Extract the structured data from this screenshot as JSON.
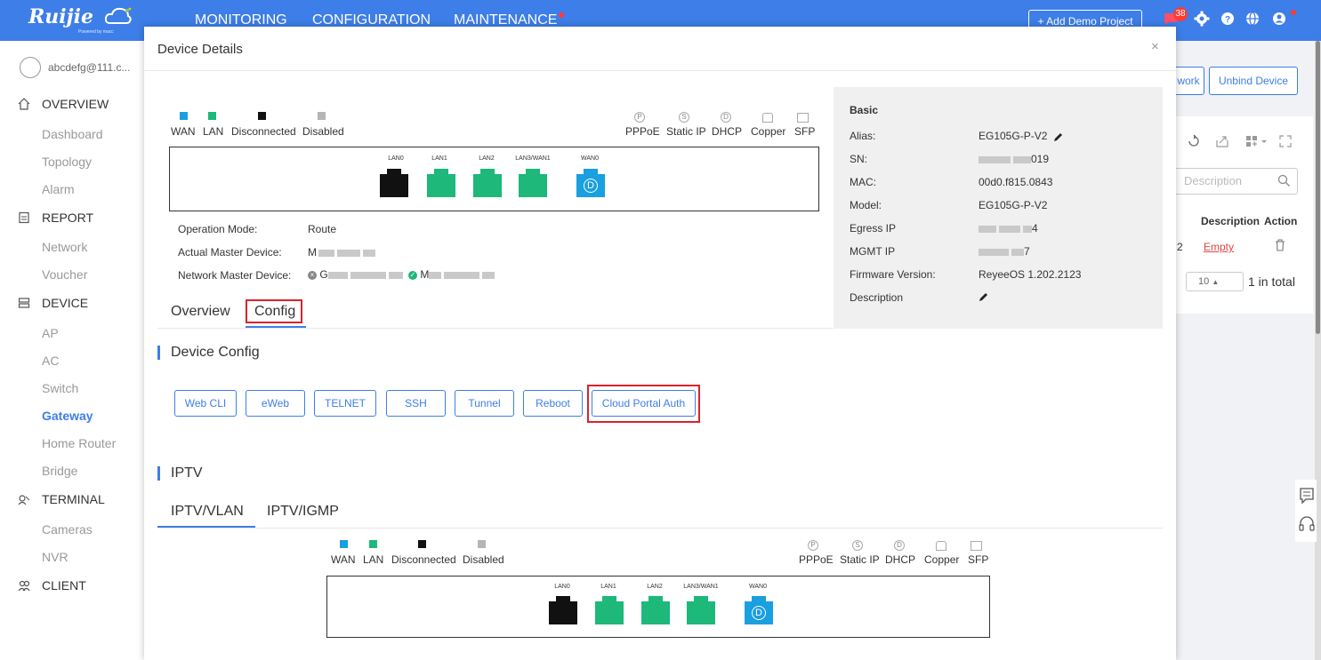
{
  "topbar": {
    "logo": "Ruijie",
    "logo_sub": "Powered by macc",
    "nav": [
      "MONITORING",
      "CONFIGURATION",
      "MAINTENANCE"
    ],
    "add_demo": "+ Add Demo Project",
    "notif_count": "38"
  },
  "sidebar": {
    "account": "abcdefg@111.c...",
    "sections": {
      "overview": "OVERVIEW",
      "report": "REPORT",
      "device": "DEVICE",
      "terminal": "TERMINAL",
      "client": "CLIENT"
    },
    "items": {
      "dashboard": "Dashboard",
      "topology": "Topology",
      "alarm": "Alarm",
      "network": "Network",
      "voucher": "Voucher",
      "ap": "AP",
      "ac": "AC",
      "switch": "Switch",
      "gateway": "Gateway",
      "home_router": "Home Router",
      "bridge": "Bridge",
      "cameras": "Cameras",
      "nvr": "NVR"
    }
  },
  "background": {
    "btn_network": "work",
    "btn_unbind": "Unbind Device",
    "search_placeholder": "Description",
    "col_description": "Description",
    "col_action": "Action",
    "row_num": "2",
    "row_empty": "Empty",
    "page_size": "10",
    "total": "1 in total"
  },
  "modal": {
    "title": "Device Details",
    "close": "×"
  },
  "legend": {
    "wan": "WAN",
    "lan": "LAN",
    "disconnected": "Disconnected",
    "disabled": "Disabled",
    "pppoe": "PPPoE",
    "static_ip": "Static IP",
    "dhcp": "DHCP",
    "copper": "Copper",
    "sfp": "SFP",
    "colors": {
      "wan": "#1a9fe0",
      "lan": "#1db87a",
      "disconnected": "#111111",
      "disabled": "#b5b5b5"
    }
  },
  "ports": {
    "lan0": "LAN0",
    "lan1": "LAN1",
    "lan2": "LAN2",
    "lan3": "LAN3/WAN1",
    "wan0": "WAN0",
    "wan0_mode": "D"
  },
  "device_info": {
    "operation_mode_label": "Operation Mode:",
    "operation_mode": "Route",
    "actual_master_label": "Actual Master Device:",
    "actual_master": "M",
    "network_master_label": "Network Master Device:",
    "network_master_a": "G",
    "network_master_b": "M"
  },
  "tabs": {
    "overview": "Overview",
    "config": "Config"
  },
  "basic": {
    "title": "Basic",
    "alias_label": "Alias:",
    "alias": "EG105G-P-V2",
    "sn_label": "SN:",
    "sn": "019",
    "mac_label": "MAC:",
    "mac": "00d0.f815.0843",
    "model_label": "Model:",
    "model": "EG105G-P-V2",
    "egress_label": "Egress IP",
    "egress": "4",
    "mgmt_label": "MGMT IP",
    "mgmt": "7",
    "firmware_label": "Firmware Version:",
    "firmware": "ReyeeOS 1.202.2123",
    "description_label": "Description"
  },
  "device_config": {
    "title": "Device Config",
    "buttons": {
      "web_cli": "Web CLI",
      "eweb": "eWeb",
      "telnet": "TELNET",
      "ssh": "SSH",
      "tunnel": "Tunnel",
      "reboot": "Reboot",
      "cloud_portal": "Cloud Portal Auth"
    }
  },
  "iptv": {
    "title": "IPTV",
    "tab_vlan": "IPTV/VLAN",
    "tab_igmp": "IPTV/IGMP"
  }
}
